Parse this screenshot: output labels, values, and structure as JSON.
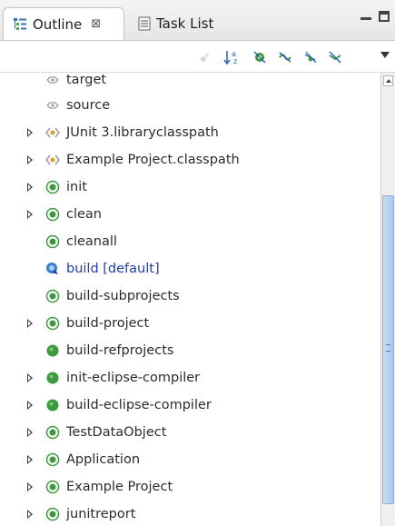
{
  "tabs": [
    {
      "label": "Outline",
      "close_glyph": "⊠",
      "icon": "outline-icon"
    },
    {
      "label": "Task List",
      "icon": "task-list-icon"
    }
  ],
  "toolbar": {
    "buttons": [
      "collapse-all-icon",
      "sort-alpha-icon",
      "hide-fields-icon",
      "hide-static-icon",
      "hide-nonpublic-icon",
      "hide-local-types-icon"
    ]
  },
  "tree": {
    "items": [
      {
        "label": "target",
        "icon": "property-icon",
        "expandable": false,
        "default": false
      },
      {
        "label": "source",
        "icon": "property-icon",
        "expandable": false,
        "default": false
      },
      {
        "label": "JUnit 3.libraryclasspath",
        "icon": "path-icon",
        "expandable": true,
        "default": false
      },
      {
        "label": "Example Project.classpath",
        "icon": "path-icon",
        "expandable": true,
        "default": false
      },
      {
        "label": "init",
        "icon": "target-icon",
        "expandable": true,
        "default": false
      },
      {
        "label": "clean",
        "icon": "target-icon",
        "expandable": true,
        "default": false
      },
      {
        "label": "cleanall",
        "icon": "target-icon",
        "expandable": false,
        "default": false
      },
      {
        "label": "build [default]",
        "icon": "default-target-icon",
        "expandable": false,
        "default": true
      },
      {
        "label": "build-subprojects",
        "icon": "target-icon",
        "expandable": false,
        "default": false
      },
      {
        "label": "build-project",
        "icon": "target-icon",
        "expandable": true,
        "default": false
      },
      {
        "label": "build-refprojects",
        "icon": "target-filled-icon",
        "expandable": false,
        "default": false
      },
      {
        "label": "init-eclipse-compiler",
        "icon": "target-filled-icon",
        "expandable": true,
        "default": false
      },
      {
        "label": "build-eclipse-compiler",
        "icon": "target-filled-icon",
        "expandable": true,
        "default": false
      },
      {
        "label": "TestDataObject",
        "icon": "target-icon",
        "expandable": true,
        "default": false
      },
      {
        "label": "Application",
        "icon": "target-icon",
        "expandable": true,
        "default": false
      },
      {
        "label": "Example Project",
        "icon": "target-icon",
        "expandable": true,
        "default": false
      },
      {
        "label": "junitreport",
        "icon": "target-icon",
        "expandable": true,
        "default": false
      }
    ]
  },
  "colors": {
    "target_green": "#3c9a3c",
    "default_blue": "#1f3fa8",
    "scroll_thumb": "#a8c6ef"
  }
}
